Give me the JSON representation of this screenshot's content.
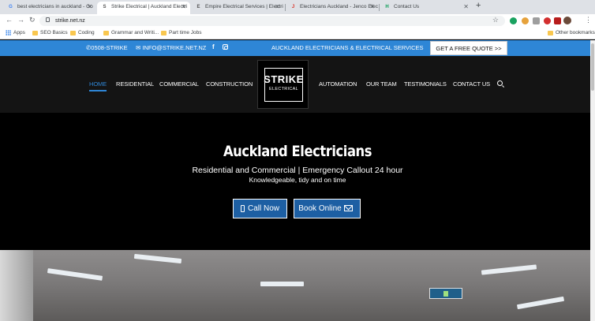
{
  "browser": {
    "tabs": [
      {
        "title": "best electricians in auckland - Go",
        "favicon": "G",
        "active": false
      },
      {
        "title": "Strike Electrical | Auckland Electri",
        "favicon": "S",
        "active": true
      },
      {
        "title": "Empire Electrical Services | Electri",
        "favicon": "E",
        "active": false
      },
      {
        "title": "Electricians Auckland - Jenco Elec",
        "favicon": "J",
        "active": false
      },
      {
        "title": "Contact Us",
        "favicon": "H",
        "active": false
      }
    ],
    "url": "strike.net.nz",
    "bookmarks": [
      "Apps",
      "SEO Basics",
      "Coding",
      "Grammar and Writi...",
      "Part time Jobs"
    ],
    "other_bookmarks": "Other bookmarks"
  },
  "topbar": {
    "phone": "0508-STRIKE",
    "email": "INFO@STRIKE.NET.NZ",
    "tagline": "AUCKLAND ELECTRICIANS & ELECTRICAL SERVICES",
    "quote_button": "GET A FREE QUOTE >>"
  },
  "nav": {
    "left": [
      "HOME",
      "RESIDENTIAL",
      "COMMERCIAL",
      "CONSTRUCTION"
    ],
    "right": [
      "AUTOMATION",
      "OUR TEAM",
      "TESTIMONIALS",
      "CONTACT US"
    ],
    "logo_line1": "STRIKE",
    "logo_line2": "ELECTRICAL"
  },
  "hero": {
    "title": "Auckland Electricians",
    "subtitle": "Residential and Commercial | Emergency Callout 24 hour",
    "tagline": "Knowledgeable, tidy and on time",
    "call_button": "Call Now",
    "book_button": "Book Online"
  },
  "colors": {
    "brand_blue": "#2e86d6",
    "button_blue": "#1d5fa3"
  }
}
